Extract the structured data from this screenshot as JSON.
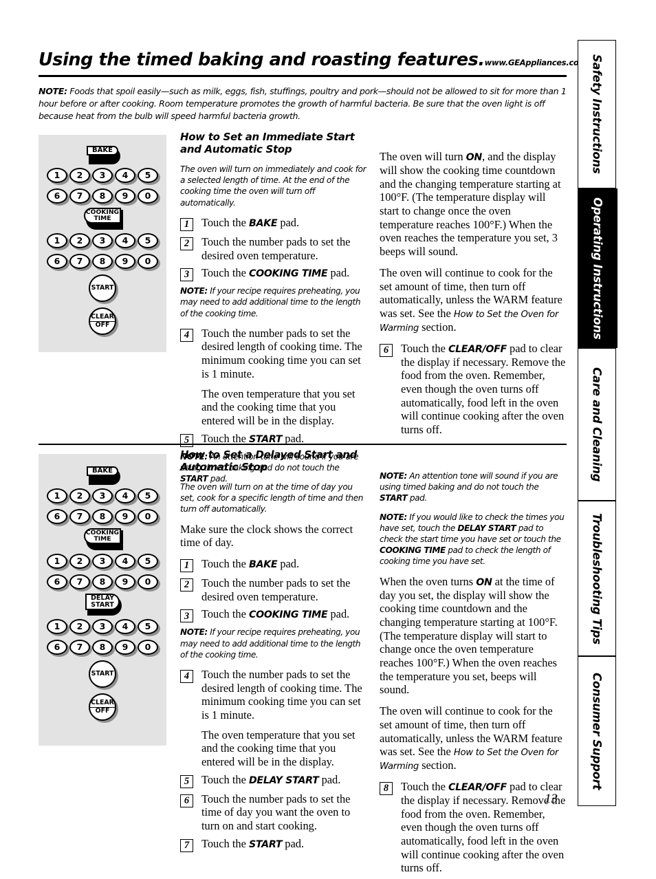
{
  "header": {
    "title": "Using the timed baking and roasting features.",
    "url": "www.GEAppliances.com"
  },
  "top_note": {
    "label": "NOTE:",
    "text": "Foods that spoil easily—such as milk, eggs, fish, stuffings, poultry and pork—should not be allowed to sit for more than 1 hour before or after cooking. Room temperature promotes the growth of harmful bacteria. Be sure that the oven light is off because heat from the bulb will speed harmful bacteria growth."
  },
  "keypads": {
    "pads": {
      "bake": "BAKE",
      "cooking_time_l1": "COOKING",
      "cooking_time_l2": "TIME",
      "delay_start_l1": "DELAY",
      "delay_start_l2": "START",
      "start": "START",
      "clear_l1": "CLEAR",
      "clear_l2": "OFF"
    },
    "number_row_1": [
      "1",
      "2",
      "3",
      "4",
      "5"
    ],
    "number_row_2": [
      "6",
      "7",
      "8",
      "9",
      "0"
    ]
  },
  "section1": {
    "heading": "How to Set an Immediate Start and Automatic Stop",
    "intro": "The oven will turn on immediately and cook for a selected length of time. At the end of the cooking time the oven will turn off automatically.",
    "steps": [
      {
        "num": "1",
        "pre": "Touch the ",
        "bold": "BAKE",
        "post": " pad."
      },
      {
        "num": "2",
        "pre": "Touch the number pads to set the desired oven temperature.",
        "bold": "",
        "post": ""
      },
      {
        "num": "3",
        "pre": "Touch the ",
        "bold": "COOKING TIME",
        "post": " pad."
      },
      {
        "num": "4",
        "pre": "Touch the number pads to set the desired length of cooking time. The minimum cooking time you can set is 1 minute.",
        "bold": "",
        "post": ""
      },
      {
        "num": "5",
        "pre": "Touch the ",
        "bold": "START",
        "post": " pad."
      },
      {
        "num": "6",
        "pre": "Touch the ",
        "bold": "CLEAR/OFF",
        "post": " pad to clear the display if necessary. Remove the food from the oven. Remember, even though the oven turns off automatically, food left in the oven will continue cooking after the oven turns off."
      }
    ],
    "step4_sub": "The oven temperature that you set and the cooking time that you entered will be in the display.",
    "note_preheat": {
      "label": "NOTE:",
      "text": " If your recipe requires preheating, you may need to add additional time to the length of the cooking time."
    },
    "note_tone": {
      "label": "NOTE:",
      "text_a": " An attention tone will sound if you are using timed baking and do not touch the ",
      "bold": "START",
      "text_b": " pad."
    },
    "right_p1_a": "The oven will turn ",
    "right_p1_bold": "ON",
    "right_p1_b": ", and the display will show the cooking time countdown and the changing temperature starting at 100°F. (The temperature display will start to change once the oven temperature reaches 100°F.) When the oven reaches the temperature you set, 3 beeps will sound.",
    "right_p2_a": "The oven will continue to cook for the set amount of time, then turn off automatically, unless the WARM feature was set. See the ",
    "right_p2_italic": "How to Set the Oven for Warming",
    "right_p2_b": " section."
  },
  "section2": {
    "heading": "How to Set a Delayed Start and Automatic Stop",
    "intro": "The oven will turn on at the time of day you set, cook for a specific length of time and then turn off automatically.",
    "clock_note": "Make sure the clock shows the correct time of day.",
    "steps": [
      {
        "num": "1",
        "pre": "Touch the ",
        "bold": "BAKE",
        "post": " pad."
      },
      {
        "num": "2",
        "pre": "Touch the number pads to set the desired oven temperature.",
        "bold": "",
        "post": ""
      },
      {
        "num": "3",
        "pre": "Touch the ",
        "bold": "COOKING TIME",
        "post": " pad."
      },
      {
        "num": "4",
        "pre": "Touch the number pads to set the desired length of cooking time. The minimum cooking time you can set is 1 minute.",
        "bold": "",
        "post": ""
      },
      {
        "num": "5",
        "pre": "Touch the ",
        "bold": "DELAY START",
        "post": " pad."
      },
      {
        "num": "6",
        "pre": "Touch the number pads to set the time of day you want the oven to turn on and start cooking.",
        "bold": "",
        "post": ""
      },
      {
        "num": "7",
        "pre": "Touch the ",
        "bold": "START",
        "post": " pad."
      },
      {
        "num": "8",
        "pre": "Touch the ",
        "bold": "CLEAR/OFF",
        "post": " pad to clear the display if necessary. Remove the food from the oven. Remember, even though the oven turns off automatically, food left in the oven will continue cooking after the oven turns off."
      }
    ],
    "step4_sub": "The oven temperature that you set and the cooking time that you entered will be in the display.",
    "note_preheat": {
      "label": "NOTE:",
      "text": " If your recipe requires preheating, you may need to add additional time to the length of the cooking time."
    },
    "note_tone": {
      "label": "NOTE:",
      "text_a": " An attention tone will sound if you are using timed baking and do not touch the ",
      "bold": "START",
      "text_b": " pad."
    },
    "note_check": {
      "label": "NOTE:",
      "text_a": " If you would like to check the times you have set, touch the ",
      "bold_a": "DELAY START",
      "text_b": " pad to check the start time you have set or touch the ",
      "bold_b": "COOKING TIME",
      "text_c": " pad to check the length of cooking time you have set."
    },
    "right_p1_a": "When the oven turns ",
    "right_p1_bold": "ON",
    "right_p1_b": " at the time of day you set, the display will show the cooking time countdown and the changing temperature starting at 100°F. (The temperature display will start to change once the oven temperature reaches 100°F.) When the oven reaches the temperature you set, beeps will sound.",
    "right_p2_a": "The oven will continue to cook for the set amount of time, then turn off automatically, unless the WARM feature was set. See the ",
    "right_p2_italic": "How to Set the Oven for Warming",
    "right_p2_b": " section."
  },
  "tabs": [
    {
      "label": "Safety Instructions",
      "active": false
    },
    {
      "label": "Operating Instructions",
      "active": true
    },
    {
      "label": "Care and Cleaning",
      "active": false
    },
    {
      "label": "Troubleshooting Tips",
      "active": false
    },
    {
      "label": "Consumer Support",
      "active": false
    }
  ],
  "page_number": "13"
}
